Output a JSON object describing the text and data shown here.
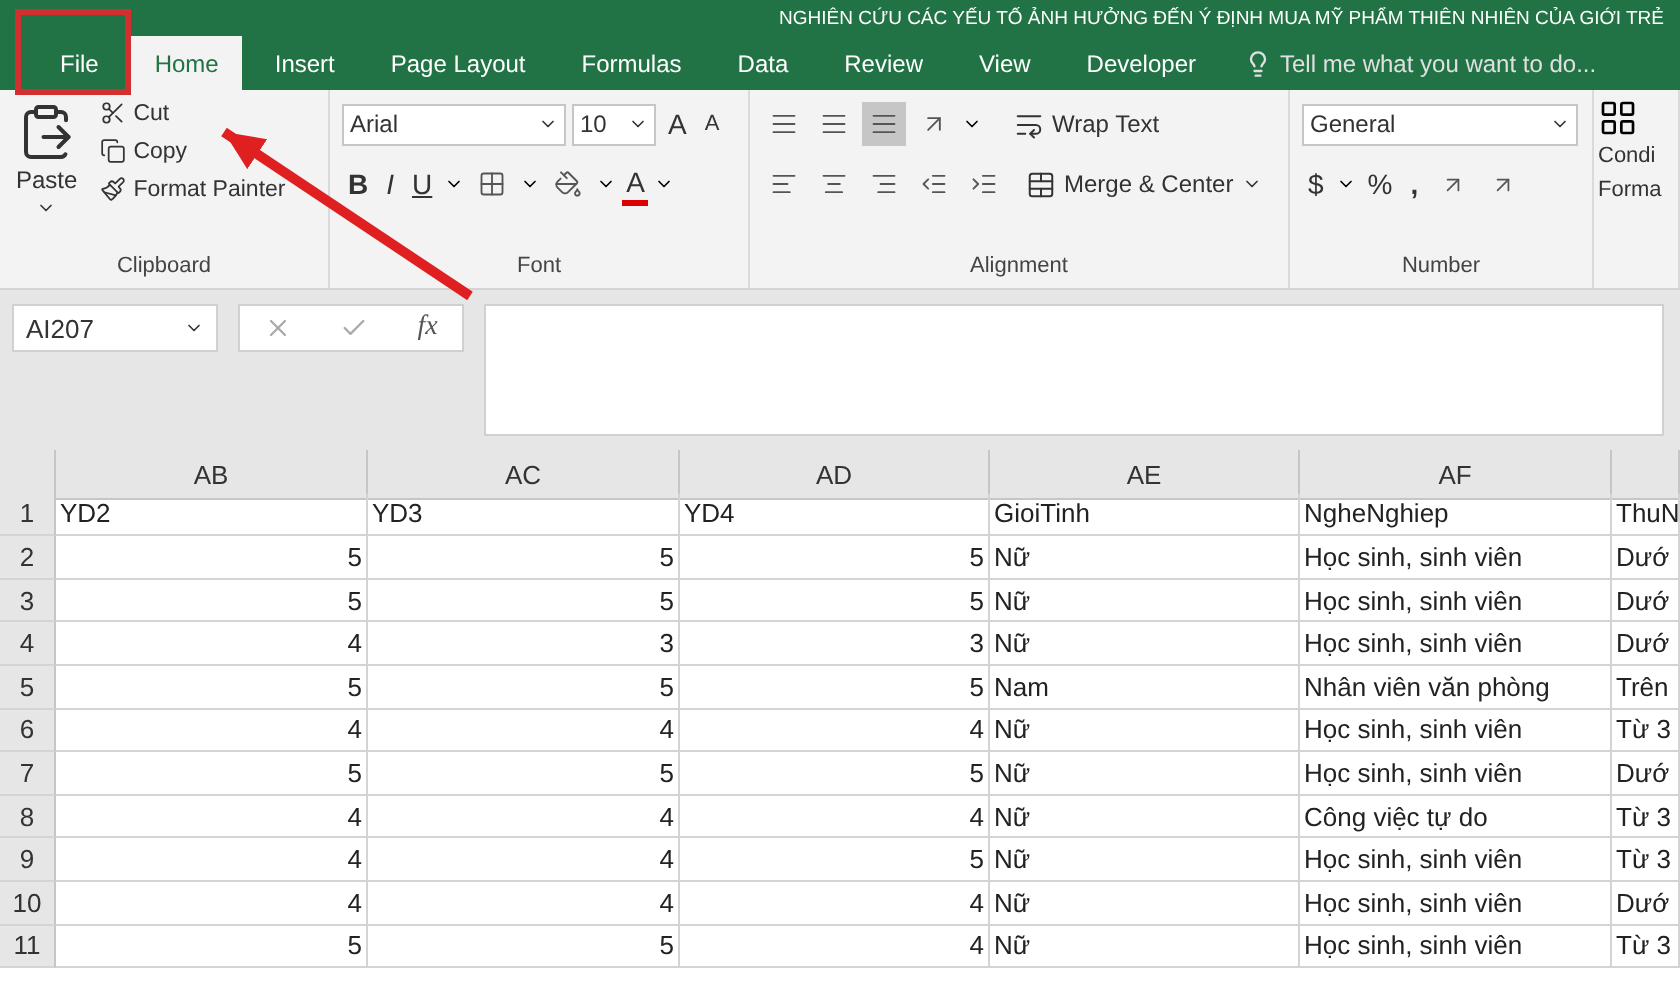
{
  "window": {
    "title": "NGHIÊN CỨU CÁC YẾU TỐ ẢNH HƯỞNG ĐẾN Ý ĐỊNH MUA MỸ PHẨM THIÊN NHIÊN CỦA GIỚI TRẺ"
  },
  "tabs": [
    {
      "label": "File",
      "selected": false
    },
    {
      "label": "Home",
      "selected": true
    },
    {
      "label": "Insert",
      "selected": false
    },
    {
      "label": "Page Layout",
      "selected": false
    },
    {
      "label": "Formulas",
      "selected": false
    },
    {
      "label": "Data",
      "selected": false
    },
    {
      "label": "Review",
      "selected": false
    },
    {
      "label": "View",
      "selected": false
    },
    {
      "label": "Developer",
      "selected": false
    }
  ],
  "tell_me": {
    "placeholder": "Tell me what you want to do..."
  },
  "ribbon": {
    "clipboard": {
      "label": "Clipboard",
      "paste": "Paste",
      "cut": "Cut",
      "copy": "Copy",
      "format_painter": "Format Painter"
    },
    "font": {
      "label": "Font",
      "font_name": "Arial",
      "font_size": "10",
      "grow": "A",
      "shrink": "A",
      "bold": "B",
      "italic": "I",
      "underline": "U",
      "font_color": "A"
    },
    "alignment": {
      "label": "Alignment",
      "vertical": [
        {
          "selected": false
        },
        {
          "selected": false
        },
        {
          "selected": true
        }
      ],
      "wrap_text": "Wrap Text",
      "merge_center": "Merge & Center"
    },
    "number": {
      "label": "Number",
      "format": "General",
      "currency": "$",
      "percent": "%",
      "comma": ","
    },
    "styles": {
      "lines": [
        "Condi",
        "Forma"
      ]
    }
  },
  "formula_bar": {
    "name_box": "AI207",
    "function_label": "fx"
  },
  "sheet": {
    "columns": [
      {
        "label": "AB",
        "kind": "number"
      },
      {
        "label": "AC",
        "kind": "number"
      },
      {
        "label": "AD",
        "kind": "number"
      },
      {
        "label": "AE",
        "kind": "text"
      },
      {
        "label": "AF",
        "kind": "text"
      }
    ],
    "rows": [
      {
        "number": "1",
        "cells": [
          "YD2",
          "YD3",
          "YD4",
          "GioiTinh",
          "NgheNghiep",
          "ThuN"
        ],
        "kind": "header"
      },
      {
        "number": "2",
        "cells": [
          "5",
          "5",
          "5",
          "Nữ",
          "Học sinh, sinh viên",
          "Dướ"
        ],
        "kind": "data"
      },
      {
        "number": "3",
        "cells": [
          "5",
          "5",
          "5",
          "Nữ",
          "Học sinh, sinh viên",
          "Dướ"
        ],
        "kind": "data"
      },
      {
        "number": "4",
        "cells": [
          "4",
          "3",
          "3",
          "Nữ",
          "Học sinh, sinh viên",
          "Dướ"
        ],
        "kind": "data"
      },
      {
        "number": "5",
        "cells": [
          "5",
          "5",
          "5",
          "Nam",
          "Nhân viên văn phòng",
          "Trên"
        ],
        "kind": "data"
      },
      {
        "number": "6",
        "cells": [
          "4",
          "4",
          "4",
          "Nữ",
          "Học sinh, sinh viên",
          "Từ 3"
        ],
        "kind": "data"
      },
      {
        "number": "7",
        "cells": [
          "5",
          "5",
          "5",
          "Nữ",
          "Học sinh, sinh viên",
          "Dướ"
        ],
        "kind": "data"
      },
      {
        "number": "8",
        "cells": [
          "4",
          "4",
          "4",
          "Nữ",
          "Công việc tự do",
          "Từ 3"
        ],
        "kind": "data"
      },
      {
        "number": "9",
        "cells": [
          "4",
          "4",
          "5",
          "Nữ",
          "Học sinh, sinh viên",
          "Từ 3"
        ],
        "kind": "data"
      },
      {
        "number": "10",
        "cells": [
          "4",
          "4",
          "4",
          "Nữ",
          "Học sinh, sinh viên",
          "Dướ"
        ],
        "kind": "data"
      },
      {
        "number": "11",
        "cells": [
          "5",
          "5",
          "4",
          "Nữ",
          "Học sinh, sinh viên",
          "Từ 3"
        ],
        "kind": "data"
      }
    ]
  }
}
